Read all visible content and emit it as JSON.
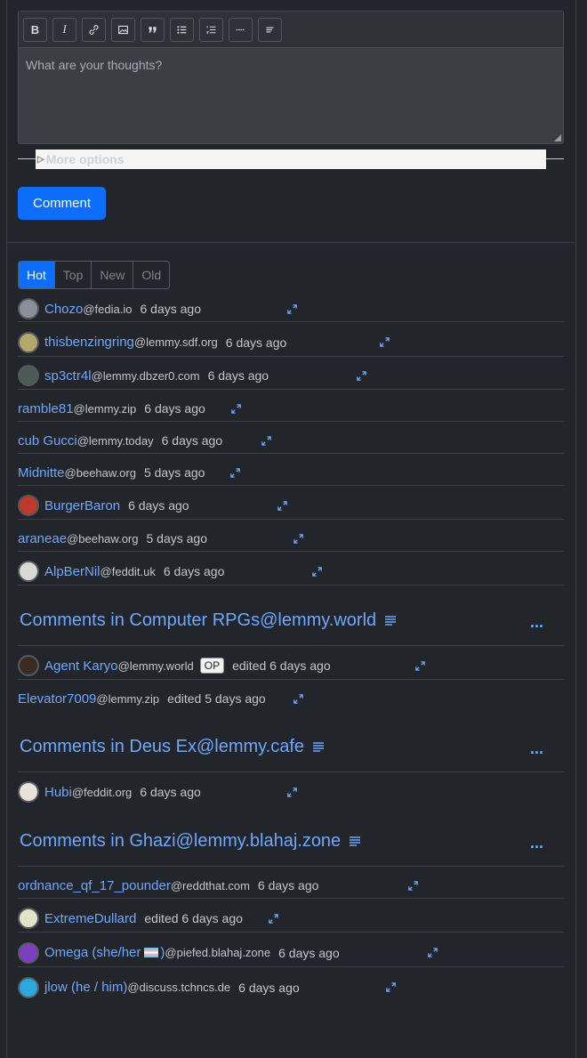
{
  "editor": {
    "placeholder": "What are your thoughts?",
    "toolbar_icons": [
      "bold-icon",
      "italic-icon",
      "link-icon",
      "image-icon",
      "quote-icon",
      "bullet-list-icon",
      "numbered-list-icon",
      "horizontal-rule-icon",
      "left-align-icon"
    ],
    "toolbar_glyphs": {
      "bold": "B",
      "italic": "I"
    }
  },
  "more_options": "More options",
  "comment_button": "Comment",
  "sort_tabs": [
    {
      "label": "Hot",
      "active": true
    },
    {
      "label": "Top",
      "active": false
    },
    {
      "label": "New",
      "active": false
    },
    {
      "label": "Old",
      "active": false
    }
  ],
  "comments": [
    {
      "user": "Chozo",
      "instance": "@fedia.io",
      "time": "6 days ago",
      "avatar_color": "#8a8f99"
    },
    {
      "user": "thisbenzingring",
      "instance": "@lemmy.sdf.org",
      "time": "6 days ago",
      "avatar_color": "#b5a66a"
    },
    {
      "user": "sp3ctr4l",
      "instance": "@lemmy.dbzer0.com",
      "time": "6 days ago",
      "avatar_color": "#4d5a55"
    },
    {
      "user": "ramble81",
      "instance": "@lemmy.zip",
      "time": "6 days ago"
    },
    {
      "user": "cub Gucci",
      "instance": "@lemmy.today",
      "time": "6 days ago"
    },
    {
      "user": "Midnitte",
      "instance": "@beehaw.org",
      "time": "5 days ago"
    },
    {
      "user": "BurgerBaron",
      "instance": "",
      "time": "6 days ago",
      "avatar_color": "#c0392b"
    },
    {
      "user": "araneae",
      "instance": "@beehaw.org",
      "time": "5 days ago"
    },
    {
      "user": "AlpBerNil",
      "instance": "@feddit.uk",
      "time": "6 days ago",
      "avatar_color": "#d9d9d9"
    }
  ],
  "groups": [
    {
      "title": "Comments in Computer RPGs@lemmy.world",
      "more": "...",
      "comments": [
        {
          "user": "Agent Karyo",
          "instance": "@lemmy.world",
          "badge": "OP",
          "time": "edited 6 days ago",
          "avatar_color": "#3a2c22"
        },
        {
          "user": "Elevator7009",
          "instance": "@lemmy.zip",
          "time": "edited 5 days ago"
        }
      ]
    },
    {
      "title": "Comments in Deus Ex@lemmy.cafe",
      "more": "...",
      "comments": [
        {
          "user": "Hubi",
          "instance": "@feddit.org",
          "time": "6 days ago",
          "avatar_color": "#e8e2da"
        }
      ]
    },
    {
      "title": "Comments in Ghazi@lemmy.blahaj.zone",
      "more": "...",
      "comments": [
        {
          "user": "ordnance_qf_17_pounder",
          "instance": "@reddthat.com",
          "time": "6 days ago"
        },
        {
          "user": "ExtremeDullard",
          "instance": "",
          "time": "edited 6 days ago",
          "avatar_color": "#e6e4c8"
        },
        {
          "user": "Omega (she/her",
          "user_suffix": ")",
          "flag": "trans-flag",
          "instance": "@piefed.blahaj.zone",
          "time": "6 days ago",
          "avatar_color": "#7b3fbf"
        },
        {
          "user": "jlow (he / him)",
          "instance": "@discuss.tchncs.de",
          "time": "6 days ago",
          "avatar_color": "#2aa8e0"
        }
      ]
    }
  ]
}
